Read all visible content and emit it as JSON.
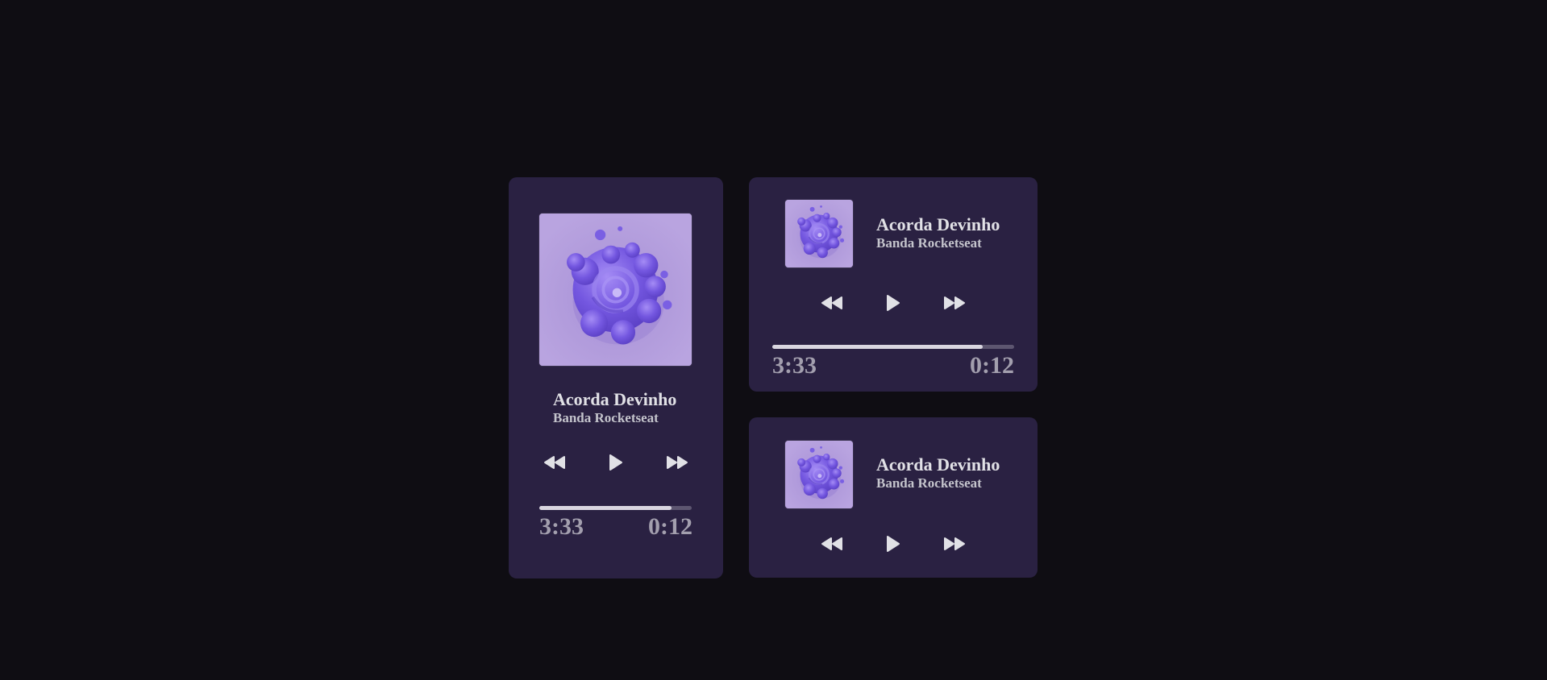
{
  "players": [
    {
      "id": "player-large",
      "title": "Acorda Devinho",
      "artist": "Banda Rocketseat",
      "time_total": "3:33",
      "time_current": "0:12",
      "progress": 0.87,
      "controls": {
        "prev_icon": "rewind-icon",
        "play_icon": "play-icon",
        "next_icon": "fast-forward-icon"
      }
    },
    {
      "id": "player-compact",
      "title": "Acorda Devinho",
      "artist": "Banda Rocketseat",
      "time_total": "3:33",
      "time_current": "0:12",
      "progress": 0.87,
      "controls": {
        "prev_icon": "rewind-icon",
        "play_icon": "play-icon",
        "next_icon": "fast-forward-icon"
      }
    },
    {
      "id": "player-mini",
      "title": "Acorda Devinho",
      "artist": "Banda Rocketseat",
      "controls": {
        "prev_icon": "rewind-icon",
        "play_icon": "play-icon",
        "next_icon": "fast-forward-icon"
      }
    }
  ],
  "colors": {
    "background": "#0f0d13",
    "card": "#2a2142",
    "text_primary": "#e1e1e6",
    "text_secondary": "#c4c4cc",
    "time_text": "#a39fae",
    "progress_track": "#5d5670",
    "progress_fill": "#d9d6e0",
    "album_bg": "#b19ada",
    "album_blob": "#7b5ee6"
  }
}
